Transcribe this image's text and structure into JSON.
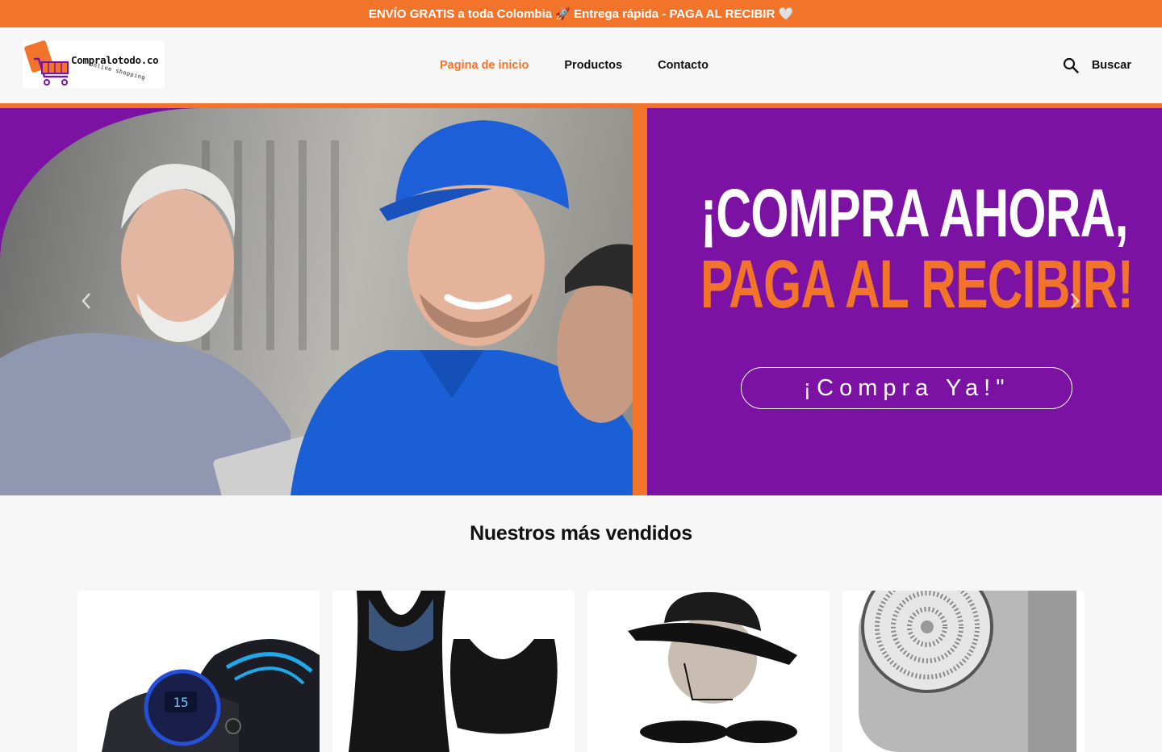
{
  "announcement": {
    "text": "ENVÍO GRATIS a toda Colombia 🚀 Entrega rápida - PAGA AL RECIBIR 🤍"
  },
  "logo": {
    "name": "Compralotodo.co",
    "tagline": "online shopping"
  },
  "nav": {
    "items": [
      {
        "label": "Pagina de inicio",
        "active": true
      },
      {
        "label": "Productos",
        "active": false
      },
      {
        "label": "Contacto",
        "active": false
      }
    ]
  },
  "search": {
    "label": "Buscar",
    "icon": "search-icon"
  },
  "hero": {
    "headline_line1": "¡COMPRA AHORA,",
    "headline_line2": "PAGA AL RECIBIR!",
    "cta_label": "¡Compra Ya!\"",
    "prev_icon": "chevron-left-icon",
    "next_icon": "chevron-right-icon"
  },
  "bestsellers": {
    "title": "Nuestros más vendidos",
    "products": [
      {
        "image": "ems-massager-pad"
      },
      {
        "image": "black-shaping-vest"
      },
      {
        "image": "black-bucket-hat"
      },
      {
        "image": "mini-electric-shaver"
      }
    ]
  },
  "colors": {
    "accent": "#f2742b",
    "purple": "#7b12a3",
    "background": "#f7f7f7"
  }
}
